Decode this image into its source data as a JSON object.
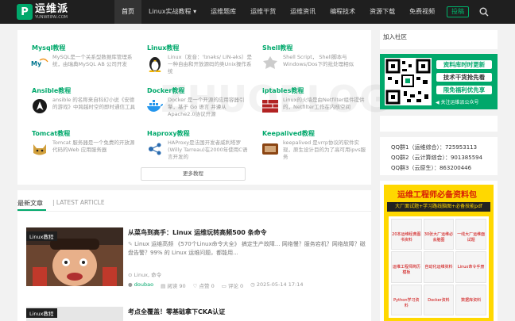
{
  "header": {
    "logo_main": "运维派",
    "logo_sub": "YUNWEIPAI.COM",
    "nav": [
      "首页",
      "Linux实战教程 ▾",
      "运维题库",
      "运维干货",
      "运维资讯",
      "编程技术",
      "资源下载",
      "免费视频"
    ],
    "login": "投稿"
  },
  "categories": [
    {
      "title": "Mysql教程",
      "desc": "MySQL是一个关系型数据库管理系统，由瑞典MySQL AB 公司开发",
      "icon": "mysql-icon"
    },
    {
      "title": "Linux教程",
      "desc": "Linux（发音：'lɪnəks/ LIN-əks）是一种自由和开放源码的类Unix操作系统",
      "icon": "tux-icon"
    },
    {
      "title": "Shell教程",
      "desc": "Shell Script， Shell脚本与Windows/Dos下的批处理相似",
      "icon": "shell-icon"
    },
    {
      "title": "Ansible教程",
      "desc": "ansible 的名称来自科幻小说《安德的游戏》中跨越时空的即时通信工具",
      "icon": "ansible-icon"
    },
    {
      "title": "Docker教程",
      "desc": "Docker 是一个开源的应用容器引擎，基于 Go 语言 并遵从Apache2.0协议开源",
      "icon": "docker-icon"
    },
    {
      "title": "iptables教程",
      "desc": "Linux的火墙是由Netfilter组件提供的，Netfilter工作在内核空间",
      "icon": "iptables-icon"
    },
    {
      "title": "Tomcat教程",
      "desc": "Tomcat 服务器是一个免费的开放源代码的Web 应用服务器",
      "icon": "tomcat-icon"
    },
    {
      "title": "Haproxy教程",
      "desc": "HAProxy是法国开发者威利塔罗(Willy Tarreau)在2000年使用C语言开发的",
      "icon": "haproxy-icon"
    },
    {
      "title": "Keepalived教程",
      "desc": "keepalived 是vrrp协议的软件实现，原生设计目的为了高可用ipvs服务",
      "icon": "keepalived-icon"
    }
  ],
  "more_label": "更多教程",
  "latest": {
    "title": "最新文章",
    "en": "| LATEST ARTICLE",
    "article1": {
      "tag": "Linux教程",
      "title": "从菜鸟到高手：Linux 运维玩转高频500 条命令",
      "desc": "Linux 运维高频 《570个Linux命令大全》 搞定生产故障... 网络慢？服务宕机？网络故障？磁盘告警？99% 的 Linux 运维问题，都能用...",
      "tags": "Linux, 命令",
      "author": "doubao",
      "views": "阅读 90",
      "likes": "点赞 0",
      "comments": "评论 0",
      "date": "2025-05-14 17:14"
    },
    "article2": {
      "tag": "Linux教程",
      "title": "考点全覆盖！零基础拿下CKA认证"
    }
  },
  "sidebar": {
    "join_title": "加入社区",
    "qr_lines": [
      "资料库时时更新",
      "技术干货抢先看",
      "限免福利优先享"
    ],
    "qr_foot": "◀ 关注运维派公众号",
    "qq": [
      "QQ群1（运维综合）：725953113",
      "QQ群2（云计算综合）：901385594",
      "QQ群3（云原生）：863200446"
    ],
    "pdf_head": "运维工程师必备资料包",
    "pdf_sub": "大厂面试题+学习路线脑图+必备技能pdf",
    "pdf_cells": [
      "20本运维经典图书资料",
      "30张大厂运维必会脑图",
      "一线大厂运维面试题",
      "运维工程师简历模板",
      "自动化运维资料",
      "Linux命令手册",
      "Python学习资料",
      "Docker资料",
      "数据库资料"
    ]
  },
  "colors": {
    "accent": "#00a86b",
    "header_bg": "#1f1f1f",
    "pdf_bg": "#ffd800"
  }
}
